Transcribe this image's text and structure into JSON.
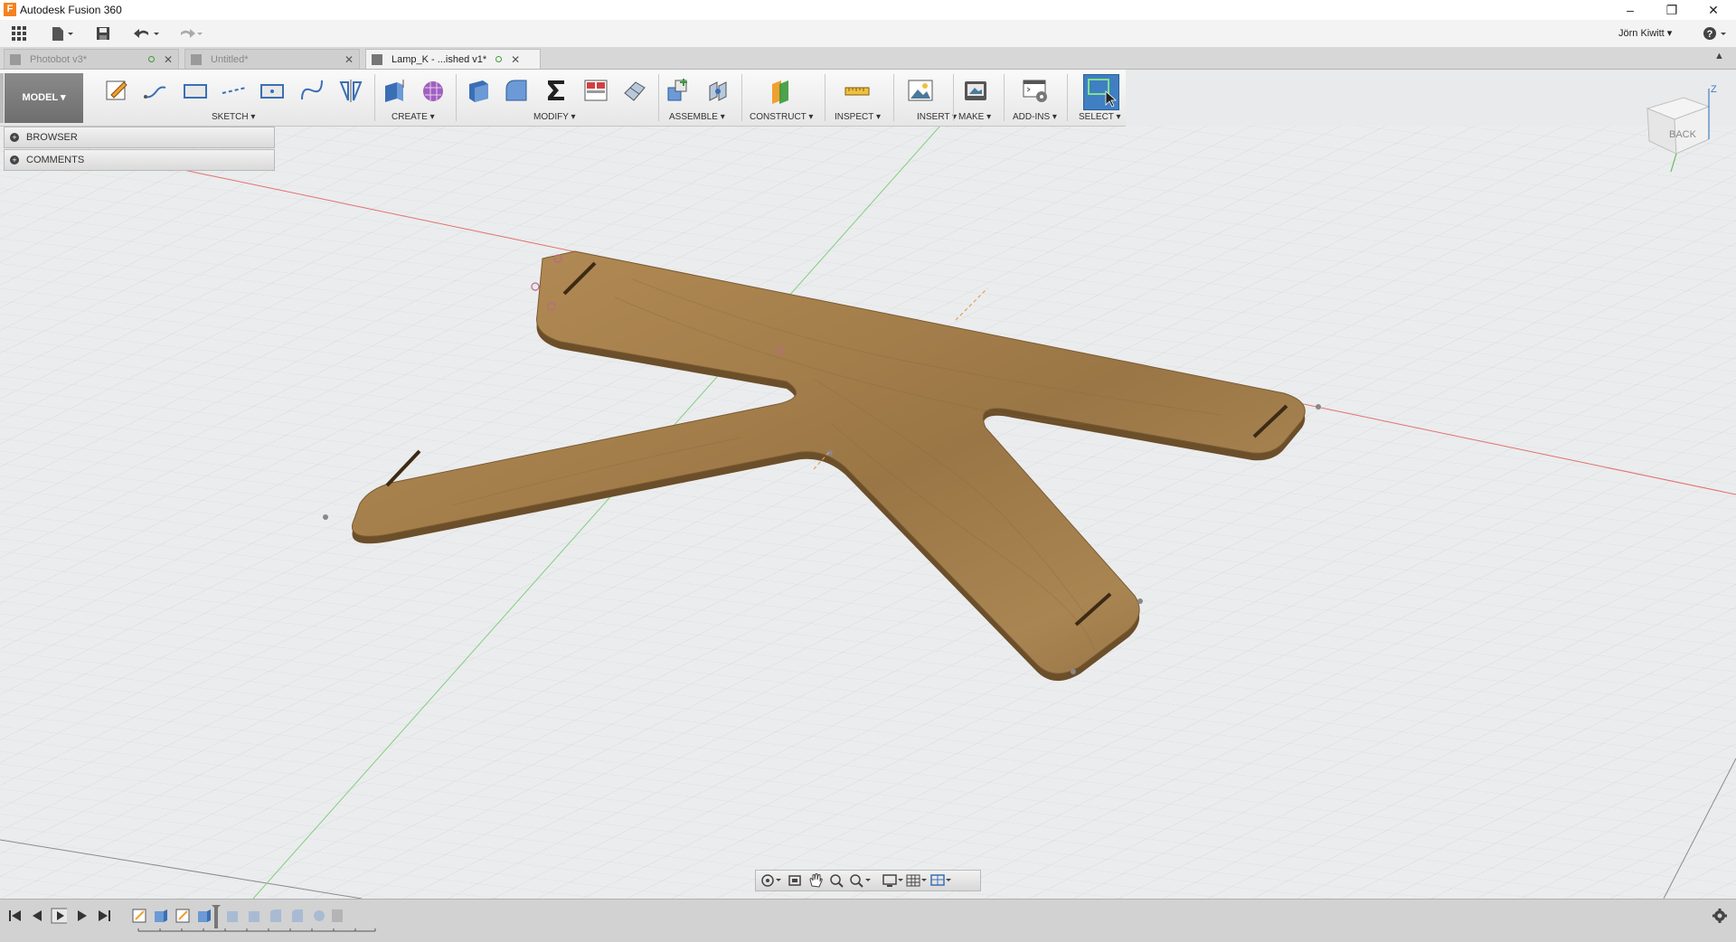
{
  "window": {
    "title": "Autodesk Fusion 360",
    "logo_letter": "F",
    "minimize": "–",
    "restore": "❐",
    "close": "✕"
  },
  "quick_access": {
    "user": "Jörn Kiwitt ▾",
    "help": "?"
  },
  "tabs": [
    {
      "label": "Photobot v3*",
      "active": false
    },
    {
      "label": "Untitled*",
      "active": false
    },
    {
      "label": "Lamp_K - ...ished v1*",
      "active": true
    }
  ],
  "toolbar": {
    "workspace": "MODEL ▾",
    "groups": {
      "sketch": "SKETCH ▾",
      "create": "CREATE ▾",
      "modify": "MODIFY ▾",
      "assemble": "ASSEMBLE ▾",
      "construct": "CONSTRUCT ▾",
      "inspect": "INSPECT ▾",
      "insert": "INSERT ▾",
      "make": "MAKE ▾",
      "addins": "ADD-INS ▾",
      "select": "SELECT ▾"
    }
  },
  "browser_panels": {
    "browser": "BROWSER",
    "comments": "COMMENTS"
  },
  "view_cube": {
    "face": "BACK",
    "axis_z": "Z"
  },
  "colors": {
    "wood": "#a8824e",
    "wood_dark": "#6b4e2a",
    "select_blue": "#3f7fc2",
    "grid": "#d0d1d3"
  }
}
